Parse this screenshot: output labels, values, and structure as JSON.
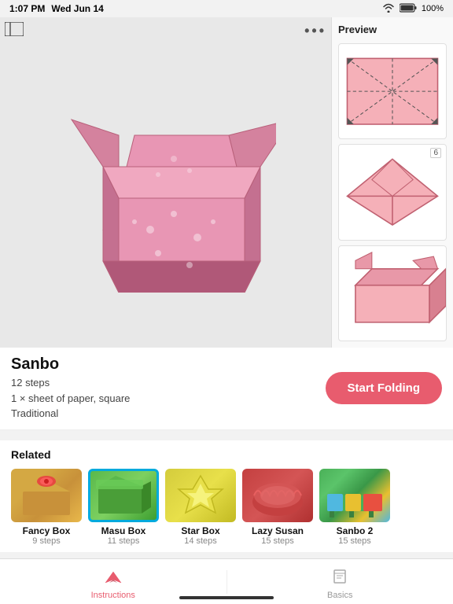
{
  "statusBar": {
    "time": "1:07 PM",
    "date": "Wed Jun 14",
    "wifi": "WiFi",
    "battery": "100%"
  },
  "toolbar": {
    "dotsLabel": "•••"
  },
  "preview": {
    "title": "Preview",
    "stepNumber": "6"
  },
  "origami": {
    "name": "Sanbo",
    "steps": "12 steps",
    "materials": "1 × sheet of paper, square",
    "style": "Traditional",
    "startButton": "Start Folding"
  },
  "related": {
    "title": "Related",
    "items": [
      {
        "name": "Fancy Box",
        "steps": "9 steps",
        "thumb": "fancy"
      },
      {
        "name": "Masu Box",
        "steps": "11 steps",
        "thumb": "masu",
        "highlighted": true
      },
      {
        "name": "Star Box",
        "steps": "14 steps",
        "thumb": "star"
      },
      {
        "name": "Lazy Susan",
        "steps": "15 steps",
        "thumb": "lazy"
      },
      {
        "name": "Sanbo 2",
        "steps": "15 steps",
        "thumb": "sanbo2"
      }
    ]
  },
  "tabs": [
    {
      "label": "Instructions",
      "icon": "instructions-icon",
      "active": true
    },
    {
      "label": "Basics",
      "icon": "book-icon",
      "active": false
    }
  ]
}
